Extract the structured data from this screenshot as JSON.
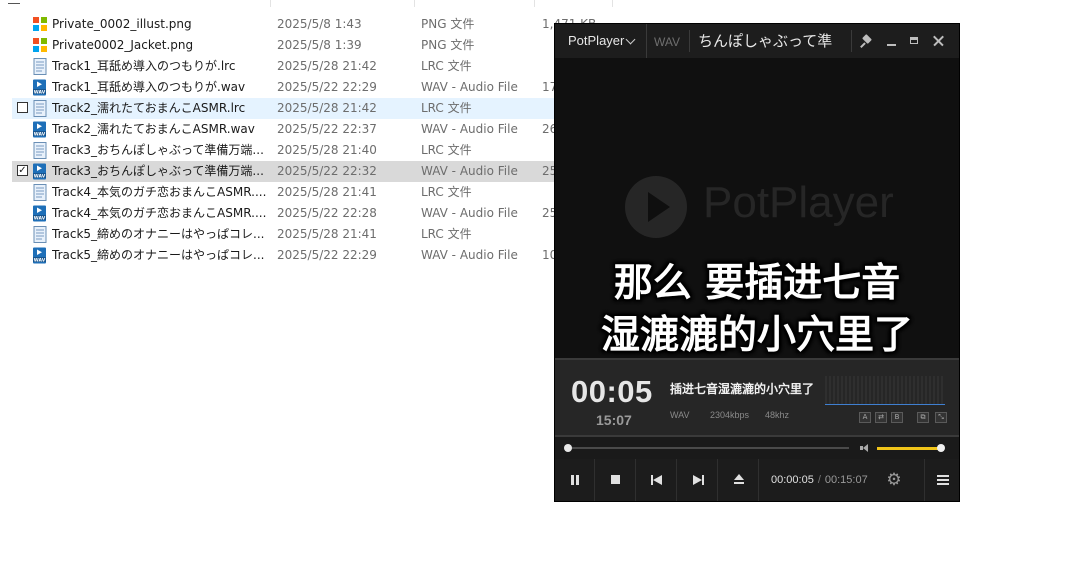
{
  "explorer": {
    "files": [
      {
        "name": "Private_0002_illust.png",
        "date": "2025/5/8 1:43",
        "type": "PNG 文件",
        "size": "1,471 KB",
        "icon": "png-image-icon"
      },
      {
        "name": "Private0002_Jacket.png",
        "date": "2025/5/8 1:39",
        "type": "PNG 文件",
        "size": "",
        "icon": "png-image-icon"
      },
      {
        "name": "Track1_耳舐め導入のつもりが.lrc",
        "date": "2025/5/28 21:42",
        "type": "LRC 文件",
        "size": "",
        "icon": "text-file-icon"
      },
      {
        "name": "Track1_耳舐め導入のつもりが.wav",
        "date": "2025/5/22 22:29",
        "type": "WAV - Audio File",
        "size": "17",
        "icon": "wav-file-icon"
      },
      {
        "name": "Track2_濡れたておまんこASMR.lrc",
        "date": "2025/5/28 21:42",
        "type": "LRC 文件",
        "size": "",
        "icon": "text-file-icon",
        "state": "hover",
        "checked": false
      },
      {
        "name": "Track2_濡れたておまんこASMR.wav",
        "date": "2025/5/22 22:37",
        "type": "WAV - Audio File",
        "size": "26",
        "icon": "wav-file-icon"
      },
      {
        "name": "Track3_おちんぽしゃぶって準備万端...",
        "date": "2025/5/28 21:40",
        "type": "LRC 文件",
        "size": "",
        "icon": "text-file-icon"
      },
      {
        "name": "Track3_おちんぽしゃぶって準備万端...",
        "date": "2025/5/22 22:32",
        "type": "WAV - Audio File",
        "size": "25",
        "icon": "wav-file-icon",
        "state": "selected",
        "checked": true
      },
      {
        "name": "Track4_本気のガチ恋おまんこASMR....",
        "date": "2025/5/28 21:41",
        "type": "LRC 文件",
        "size": "",
        "icon": "text-file-icon"
      },
      {
        "name": "Track4_本気のガチ恋おまんこASMR....",
        "date": "2025/5/22 22:28",
        "type": "WAV - Audio File",
        "size": "25",
        "icon": "wav-file-icon"
      },
      {
        "name": "Track5_締めのオナニーはやっぱコレ...",
        "date": "2025/5/28 21:41",
        "type": "LRC 文件",
        "size": "",
        "icon": "text-file-icon"
      },
      {
        "name": "Track5_締めのオナニーはやっぱコレ...",
        "date": "2025/5/22 22:29",
        "type": "WAV - Audio File",
        "size": "10",
        "icon": "wav-file-icon"
      }
    ]
  },
  "player": {
    "brand": "PotPlayer",
    "format_tag": "WAV",
    "window_title": "ちんぽしゃぶって準",
    "watermark": "PotPlayer",
    "subtitle_lines": [
      "那么 要插进七音",
      "湿漉漉的小穴里了"
    ],
    "elapsed": "00:05",
    "total": "15:07",
    "scrolling_title": "插进七音湿漉漉的小穴里了",
    "meta": {
      "codec": "WAV",
      "bitrate": "2304kbps",
      "sample_rate": "48khz"
    },
    "mini_buttons": [
      "A",
      "⇄",
      "B",
      "⧉",
      "⤡"
    ],
    "seek_progress": 0.0055,
    "volume_level": 1.0,
    "timecode_current": "00:00:05",
    "timecode_sep": "/",
    "timecode_total": "00:15:07",
    "accent_color": "#f0c419"
  }
}
